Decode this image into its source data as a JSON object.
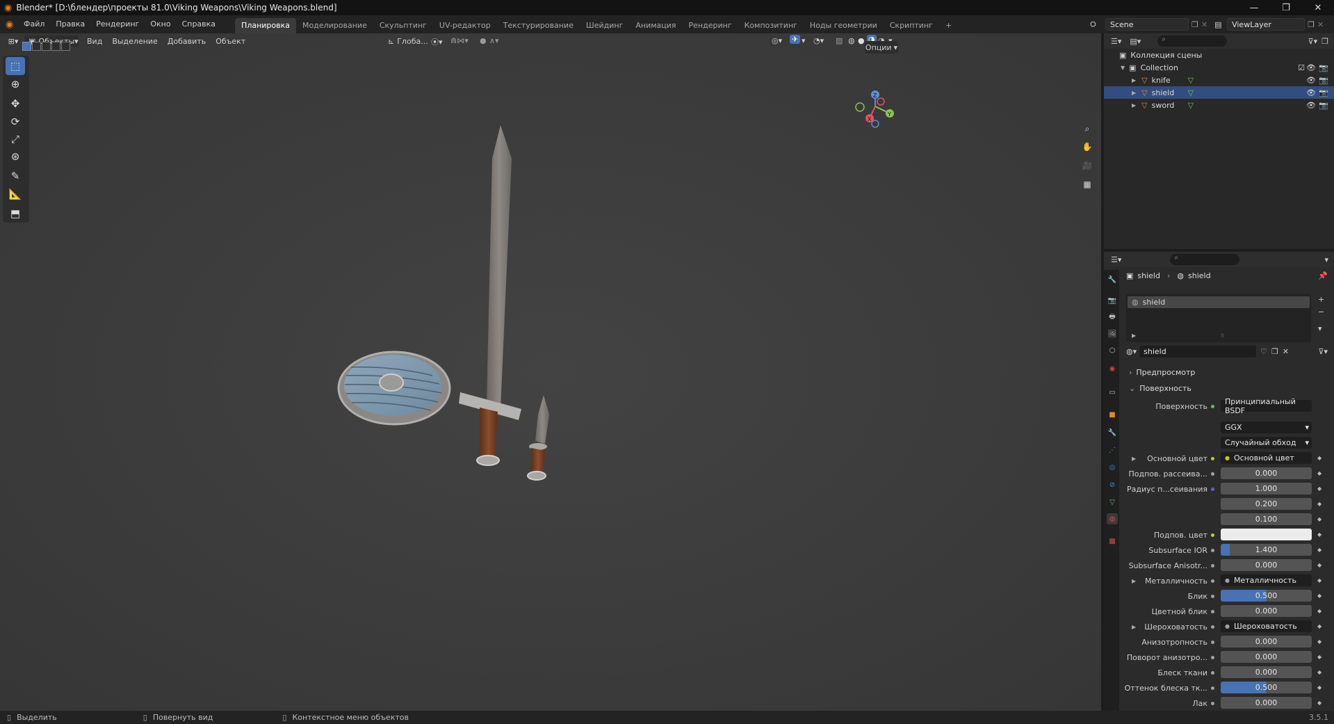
{
  "window": {
    "title": "Blender* [D:\\блендер\\проекты 81.0\\Viking Weapons\\Viking Weapons.blend]",
    "minimize": "—",
    "maximize": "❐",
    "close": "✕"
  },
  "menubar": {
    "items": [
      "Файл",
      "Правка",
      "Рендеринг",
      "Окно",
      "Справка"
    ],
    "workspaces": [
      "Планировка",
      "Моделирование",
      "Скульптинг",
      "UV-редактор",
      "Текстурирование",
      "Шейдинг",
      "Анимация",
      "Рендеринг",
      "Композитинг",
      "Ноды геометрии",
      "Скриптинг"
    ],
    "active_workspace": "Планировка",
    "add_workspace": "+",
    "scene": "Scene",
    "view_layer": "ViewLayer"
  },
  "viewport_header": {
    "mode": "Объекты",
    "menus": [
      "Вид",
      "Выделение",
      "Добавить",
      "Объект"
    ],
    "orientation": "Глоба...",
    "options": "Опции"
  },
  "gizmo": {
    "x": "X",
    "y": "Y",
    "z": "Z"
  },
  "outliner": {
    "scene_collection": "Коллекция сцены",
    "collection": "Collection",
    "objects": [
      {
        "name": "knife",
        "selected": false
      },
      {
        "name": "shield",
        "selected": true
      },
      {
        "name": "sword",
        "selected": false
      }
    ]
  },
  "properties": {
    "breadcrumb_object": "shield",
    "breadcrumb_material": "shield",
    "slot": "shield",
    "material_name": "shield",
    "sections": {
      "preview": "Предпросмотр",
      "surface": "Поверхность"
    },
    "surface_label": "Поверхность",
    "surface_value": "Принципиальный BSDF",
    "distribution": "GGX",
    "subsurface_method": "Случайный обход",
    "rows": [
      {
        "label": "Основной цвет",
        "value": "Основной цвет",
        "kind": "link",
        "dot": "#c7c729",
        "expand": true
      },
      {
        "label": "Подпов. рассеива...",
        "value": "0.000",
        "kind": "num",
        "dot": "#a1a1a1"
      },
      {
        "label": "Радиус п...сеивания",
        "value": "1.000",
        "kind": "num",
        "dot": "#6363c7"
      },
      {
        "label": "",
        "value": "0.200",
        "kind": "num",
        "dot": ""
      },
      {
        "label": "",
        "value": "0.100",
        "kind": "num",
        "dot": ""
      },
      {
        "label": "Подпов. цвет",
        "value": "",
        "kind": "color",
        "dot": "#c7c729"
      },
      {
        "label": "Subsurface IOR",
        "value": "1.400",
        "kind": "num",
        "dot": "#a1a1a1",
        "fill": "10%"
      },
      {
        "label": "Subsurface Anisotr...",
        "value": "0.000",
        "kind": "num",
        "dot": "#a1a1a1"
      },
      {
        "label": "Металличность",
        "value": "Металличность",
        "kind": "link",
        "dot": "#a1a1a1",
        "expand": true
      },
      {
        "label": "Блик",
        "value": "0.500",
        "kind": "num",
        "dot": "#a1a1a1",
        "fill": "50%"
      },
      {
        "label": "Цветной блик",
        "value": "0.000",
        "kind": "num",
        "dot": "#a1a1a1"
      },
      {
        "label": "Шероховатость",
        "value": "Шероховатость",
        "kind": "link",
        "dot": "#a1a1a1",
        "expand": true
      },
      {
        "label": "Анизотропность",
        "value": "0.000",
        "kind": "num",
        "dot": "#a1a1a1"
      },
      {
        "label": "Поворот анизотро...",
        "value": "0.000",
        "kind": "num",
        "dot": "#a1a1a1"
      },
      {
        "label": "Блеск ткани",
        "value": "0.000",
        "kind": "num",
        "dot": "#a1a1a1"
      },
      {
        "label": "Оттенок блеска тк...",
        "value": "0.500",
        "kind": "num",
        "dot": "#a1a1a1",
        "fill": "50%"
      },
      {
        "label": "Лак",
        "value": "0.000",
        "kind": "num",
        "dot": "#a1a1a1"
      }
    ]
  },
  "statusbar": {
    "select": "Выделить",
    "rotate": "Повернуть вид",
    "context": "Контекстное меню объектов",
    "version": "3.5.1"
  },
  "colors": {
    "accent": "#4772b3",
    "selected_row": "#334d80",
    "viewport_bg": "#3d3d3d"
  }
}
